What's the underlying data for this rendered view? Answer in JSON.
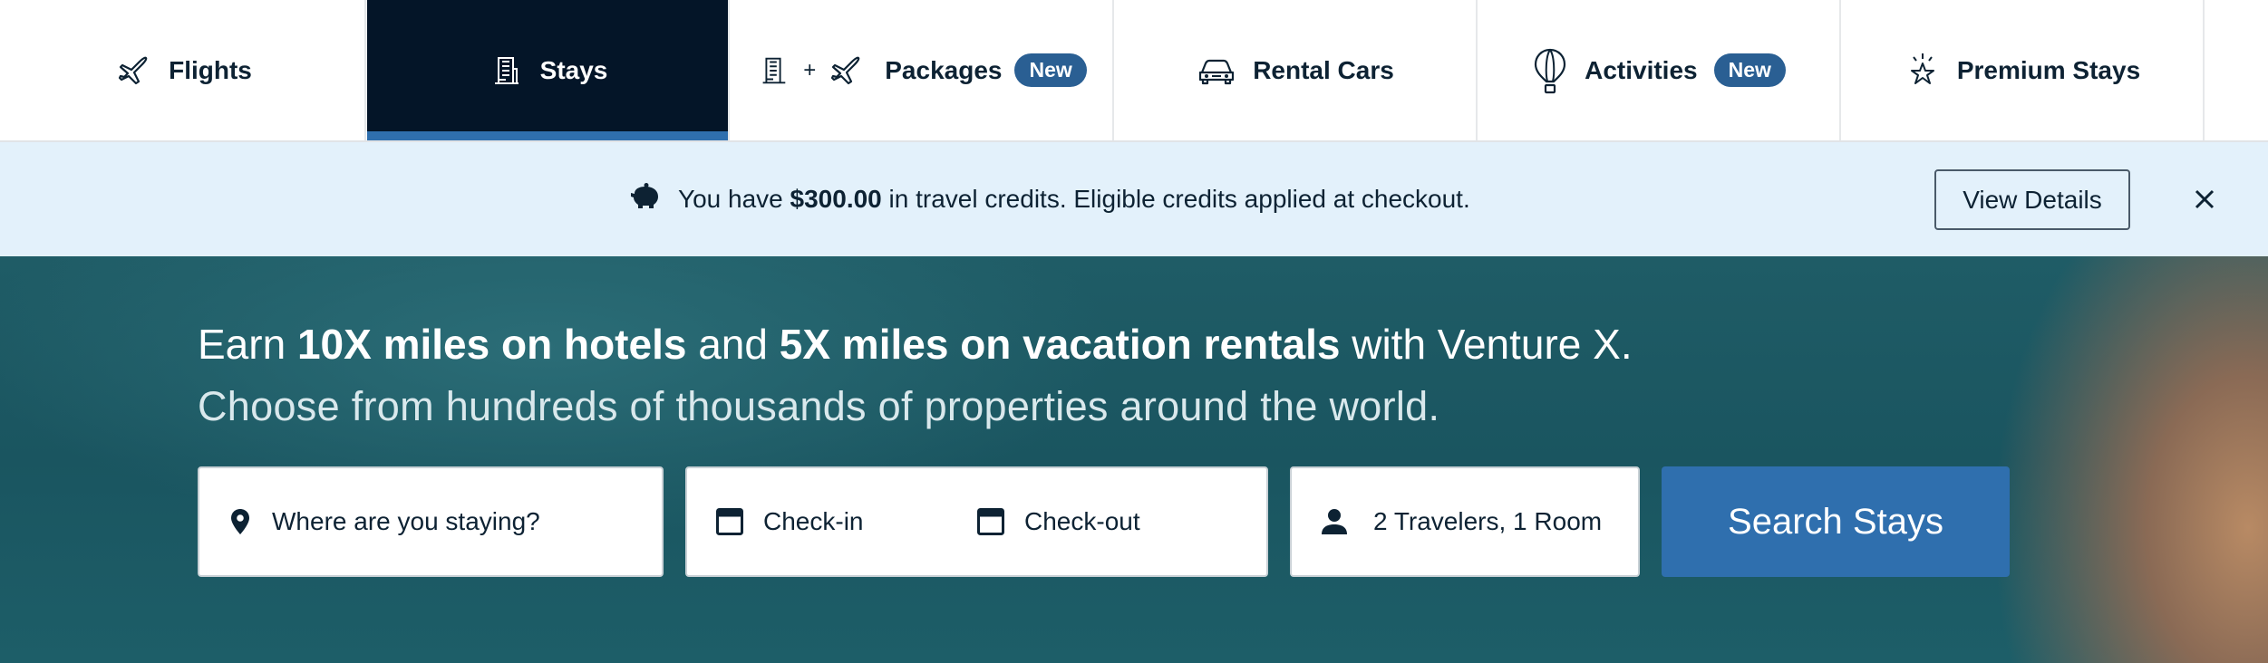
{
  "tabs": [
    {
      "label": "Flights",
      "icon": "airplane-icon",
      "active": false
    },
    {
      "label": "Stays",
      "icon": "hotel-icon",
      "active": true
    },
    {
      "label": "Packages",
      "icon": "package-icon",
      "badge": "New",
      "plus": "+",
      "active": false
    },
    {
      "label": "Rental Cars",
      "icon": "car-icon",
      "active": false
    },
    {
      "label": "Activities",
      "icon": "balloon-icon",
      "badge": "New",
      "active": false
    },
    {
      "label": "Premium Stays",
      "icon": "sparkle-star-icon",
      "active": false
    }
  ],
  "banner": {
    "prefix": "You have",
    "amount": "$300.00",
    "suffix": "in travel credits. Eligible credits applied at checkout.",
    "button": "View Details",
    "icon": "piggy-bank-icon"
  },
  "hero": {
    "line1": {
      "p1": "Earn",
      "b1": "10X miles on hotels",
      "p2": "and",
      "b2": "5X miles on vacation rentals",
      "p3": "with Venture X."
    },
    "line2": "Choose from hundreds of thousands of properties around the world."
  },
  "search": {
    "destination_placeholder": "Where are you staying?",
    "checkin_placeholder": "Check-in",
    "checkout_placeholder": "Check-out",
    "travelers": "2 Travelers, 1 Room",
    "button": "Search Stays"
  },
  "colors": {
    "active_tab": "#041528",
    "accent": "#2f6fae",
    "badge": "#2a5f93",
    "banner_bg": "#e3f1fb"
  }
}
